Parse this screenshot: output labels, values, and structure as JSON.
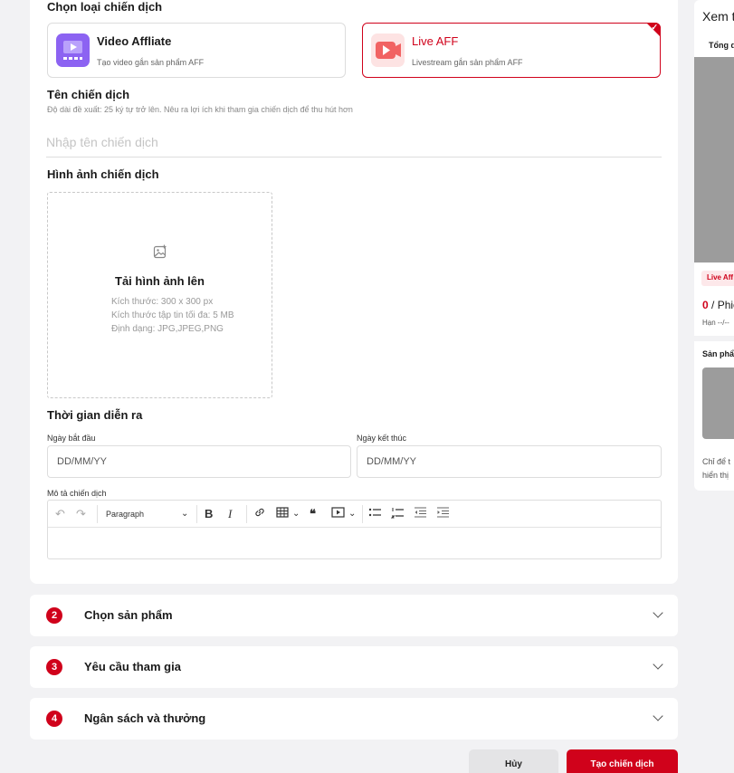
{
  "campaign_type": {
    "title": "Chọn loại chiến dịch",
    "options": [
      {
        "name": "Video Affliate",
        "desc": "Tạo video gắn sản phẩm AFF"
      },
      {
        "name": "Live AFF",
        "desc": "Livestream gắn sản phẩm AFF"
      }
    ],
    "selected_check": "✓"
  },
  "campaign_name": {
    "title": "Tên chiến dịch",
    "hint": "Độ dài đề xuất: 25 ký tự trở lên. Nêu ra lợi ích khi tham gia chiến dịch để thu hút hơn",
    "placeholder": "Nhập tên chiến dịch"
  },
  "campaign_image": {
    "title": "Hình ảnh chiến dịch",
    "upload_title": "Tải hình ảnh lên",
    "specs": [
      "Kích thước: 300 x 300 px",
      "Kích thước tập tin tối đa: 5 MB",
      "Định dạng: JPG,JPEG,PNG"
    ]
  },
  "time": {
    "title": "Thời gian diễn ra",
    "start_label": "Ngày bắt đầu",
    "start_placeholder": "DD/MM/YY",
    "end_label": "Ngày kết thúc",
    "end_placeholder": "DD/MM/YY"
  },
  "description": {
    "label": "Mô tả chiến dịch",
    "paragraph_select": "Paragraph",
    "bold": "B",
    "italic": "I",
    "quote": "❝"
  },
  "steps": [
    {
      "num": "2",
      "title": "Chọn sản phẩm"
    },
    {
      "num": "3",
      "title": "Yêu cầu tham gia"
    },
    {
      "num": "4",
      "title": "Ngân sách và thưởng"
    }
  ],
  "footer": {
    "cancel": "Hủy",
    "create": "Tạo chiến dịch"
  },
  "preview": {
    "title": "Xem t",
    "tab": "Tổng q",
    "badge": "Live Aff",
    "count": "0",
    "count_suffix": " / Phiê",
    "deadline": "Hạn --/--",
    "products": "Sản phẩ",
    "note_line1": "Chỉ để t",
    "note_line2": "hiển thị"
  },
  "colors": {
    "accent": "#d0021b",
    "video_icon": "#8c63f2",
    "live_icon": "#f16363"
  }
}
